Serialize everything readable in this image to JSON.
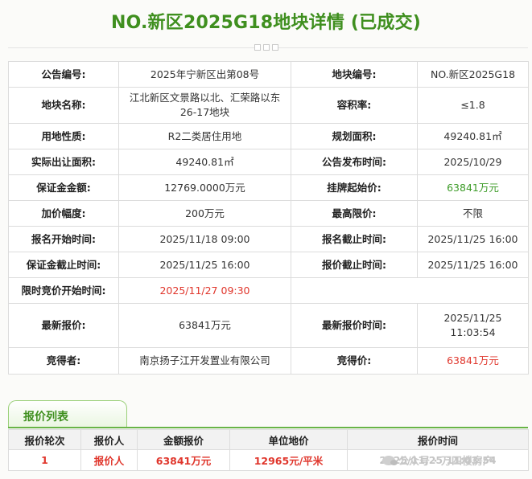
{
  "page_title": "NO.新区2025G18地块详情 (已成交)",
  "info": {
    "rows": [
      {
        "k1": "公告编号:",
        "v1": "2025年宁新区出第08号",
        "k2": "地块编号:",
        "v2": "NO.新区2025G18"
      },
      {
        "k1": "地块名称:",
        "v1": "江北新区文景路以北、汇荣路以东26-17地块",
        "k2": "容积率:",
        "v2": "≤1.8"
      },
      {
        "k1": "用地性质:",
        "v1": "R2二类居住用地",
        "k2": "规划面积:",
        "v2": "49240.81㎡"
      },
      {
        "k1": "实际出让面积:",
        "v1": "49240.81㎡",
        "k2": "公告发布时间:",
        "v2": "2025/10/29"
      },
      {
        "k1": "保证金金额:",
        "v1": "12769.0000万元",
        "k2": "挂牌起始价:",
        "v2": "63841万元"
      },
      {
        "k1": "加价幅度:",
        "v1": "200万元",
        "k2": "最高限价:",
        "v2": "不限"
      },
      {
        "k1": "报名开始时间:",
        "v1": "2025/11/18 09:00",
        "k2": "报名截止时间:",
        "v2": "2025/11/25 16:00"
      },
      {
        "k1": "保证金截止时间:",
        "v1": "2025/11/25 16:00",
        "k2": "报价截止时间:",
        "v2": "2025/11/25 16:00"
      },
      {
        "k1": "限时竞价开始时间:",
        "v1": "2025/11/27 09:30",
        "k2": "",
        "v2": ""
      },
      {
        "k1": "最新报价:",
        "v1": "63841万元",
        "k2": "最新报价时间:",
        "v2": "2025/11/25 11:03:54"
      },
      {
        "k1": "竞得者:",
        "v1": "南京扬子江开发置业有限公司",
        "k2": "竞得价:",
        "v2": "63841万元"
      }
    ],
    "colors": {
      "green": "#3c9b27",
      "red": "#e0362c"
    }
  },
  "bids": {
    "tab_label": "报价列表",
    "headers": [
      "报价轮次",
      "报价人",
      "金额报价",
      "单位地价",
      "报价时间"
    ],
    "rows": [
      {
        "round": "1",
        "bidder": "报价人",
        "amount": "63841万元",
        "unit_price": "12965元/平米",
        "time": "2025/11/25 11:03:54"
      }
    ],
    "watermark": "公众号 · 万四楼房产"
  }
}
